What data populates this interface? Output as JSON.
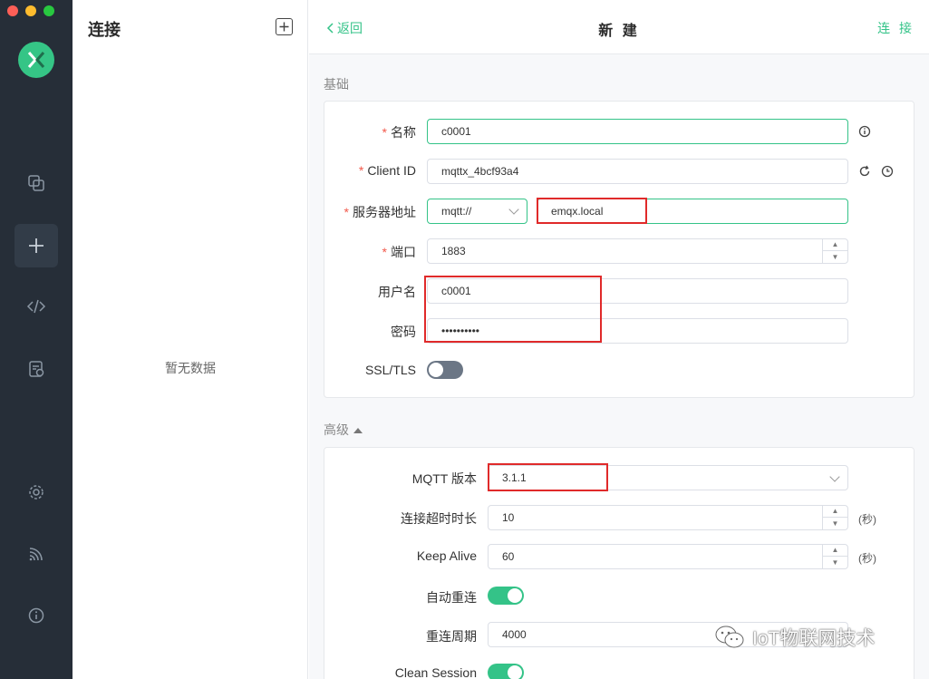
{
  "colors": {
    "accent": "#34c388",
    "rail": "#262e38",
    "required": "#f2594b",
    "highlight": "#e02a2a"
  },
  "rail": {
    "icons": [
      "connections-icon",
      "new-connection-icon",
      "script-icon",
      "log-icon",
      "settings-icon",
      "subscribe-feed-icon",
      "about-icon"
    ]
  },
  "list": {
    "title": "连接",
    "empty": "暂无数据"
  },
  "header": {
    "back": "返回",
    "title": "新 建",
    "connect": "连 接"
  },
  "basic": {
    "label": "基础",
    "name": {
      "label": "名称",
      "value": "c0001"
    },
    "client_id": {
      "label": "Client ID",
      "value": "mqttx_4bcf93a4"
    },
    "host": {
      "label": "服务器地址",
      "protocol": "mqtt://",
      "value": "emqx.local"
    },
    "port": {
      "label": "端口",
      "value": "1883"
    },
    "username": {
      "label": "用户名",
      "value": "c0001"
    },
    "password": {
      "label": "密码",
      "value": "••••••••••"
    },
    "ssl": {
      "label": "SSL/TLS",
      "enabled": false
    }
  },
  "advanced": {
    "label": "高级",
    "mqtt_version": {
      "label": "MQTT 版本",
      "value": "3.1.1"
    },
    "timeout": {
      "label": "连接超时时长",
      "value": "10",
      "unit": "(秒)"
    },
    "keep_alive": {
      "label": "Keep Alive",
      "value": "60",
      "unit": "(秒)"
    },
    "auto_reconnect": {
      "label": "自动重连",
      "enabled": true
    },
    "reconnect_period": {
      "label": "重连周期",
      "value": "4000"
    },
    "clean_session": {
      "label": "Clean Session",
      "enabled": true
    }
  },
  "watermark": {
    "text": "IoT物联网技术"
  }
}
